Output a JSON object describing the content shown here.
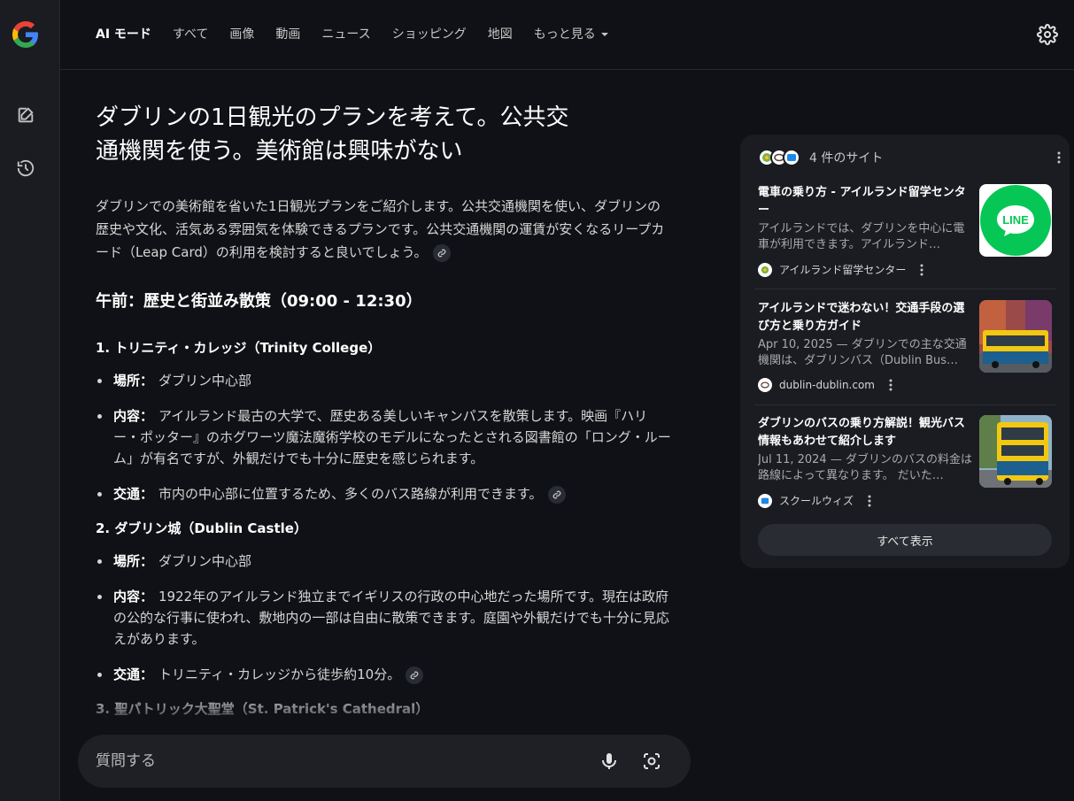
{
  "nav": {
    "tabs": [
      {
        "label": "AI モード",
        "active": true
      },
      {
        "label": "すべて"
      },
      {
        "label": "画像"
      },
      {
        "label": "動画"
      },
      {
        "label": "ニュース"
      },
      {
        "label": "ショッピング"
      },
      {
        "label": "地図"
      },
      {
        "label": "もっと見る"
      }
    ]
  },
  "rail": {
    "icons": [
      "google-logo-icon",
      "new-chat-icon",
      "history-icon"
    ]
  },
  "answer": {
    "query": "ダブリンの1日観光のプランを考えて。公共交通機関を使う。美術館は興味がない",
    "intro": "ダブリンでの美術館を省いた1日観光プランをご紹介します。公共交通機関を使い、ダブリンの歴史や文化、活気ある雰囲気を体験できるプランです。公共交通機関の運賃が安くなるリープカード（Leap Card）の利用を検討すると良いでしょう。",
    "section_title": "午前：歴史と街並み散策（09:00 - 12:30）",
    "places": [
      {
        "title": "1. トリニティ・カレッジ（Trinity College）",
        "details": [
          {
            "label": "場所：",
            "text": "ダブリン中心部"
          },
          {
            "label": "内容：",
            "text": "アイルランド最古の大学で、歴史ある美しいキャンパスを散策します。映画『ハリー・ポッター』のホグワーツ魔法魔術学校のモデルになったとされる図書館の「ロング・ルーム」が有名ですが、外観だけでも十分に歴史を感じられます。"
          },
          {
            "label": "交通：",
            "text": "市内の中心部に位置するため、多くのバス路線が利用できます。"
          }
        ]
      },
      {
        "title": "2. ダブリン城（Dublin Castle）",
        "details": [
          {
            "label": "場所：",
            "text": "ダブリン中心部"
          },
          {
            "label": "内容：",
            "text": "1922年のアイルランド独立までイギリスの行政の中心地だった場所です。現在は政府の公的な行事に使われ、敷地内の一部は自由に散策できます。庭園や外観だけでも十分に見応えがあります。"
          },
          {
            "label": "交通：",
            "text": "トリニティ・カレッジから徒歩約10分。"
          }
        ]
      },
      {
        "title": "3. 聖パトリック大聖堂（St. Patrick's Cathedral）"
      }
    ]
  },
  "ask": {
    "placeholder": "質問する"
  },
  "sources": {
    "count_label": "4 件のサイト",
    "cards": [
      {
        "title": "電車の乗り方 - アイルランド留学センター",
        "snippet": "アイルランドでは、ダブリンを中心に電車が利用できます。アイルランド…",
        "site": "アイルランド留学センター",
        "thumb_text": "LINE"
      },
      {
        "title": "アイルランドで迷わない！交通手段の選び方と乗り方ガイド",
        "snippet": "Apr 10, 2025 — ダブリンでの主な交通機関は、ダブリンバス（Dublin Bus…",
        "site": "dublin-dublin.com"
      },
      {
        "title": "ダブリンのバスの乗り方解説！観光バス情報もあわせて紹介します",
        "snippet": "Jul 11, 2024 — ダブリンのバスの料金は路線によって異なります。 だいた…",
        "site": "スクールウィズ"
      }
    ],
    "show_all_label": "すべて表示"
  },
  "colors": {
    "background": "#0f1116",
    "rail": "#1b1c22",
    "panel": "#1b1c22",
    "line_green": "#06c755",
    "bus_yellow": "#f2c811",
    "bus_blue": "#1d5f8f"
  }
}
